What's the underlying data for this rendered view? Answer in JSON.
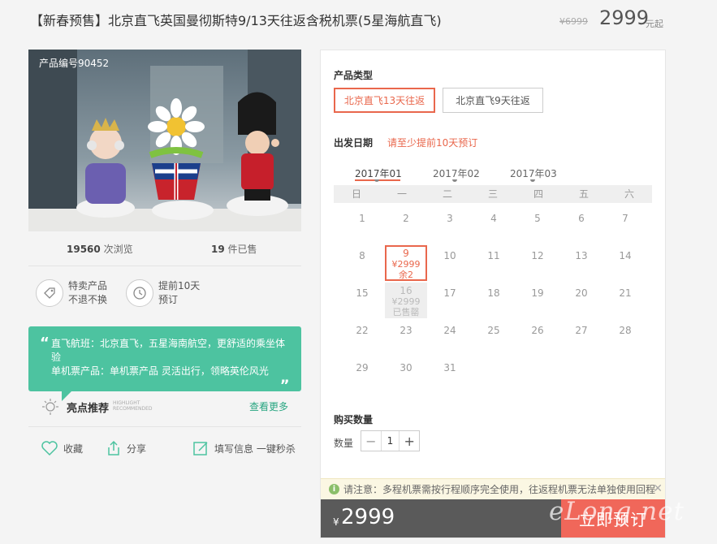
{
  "title": "【新春预售】北京直飞英国曼彻斯特9/13天往返含税机票(5星海航直飞)",
  "original_price": "¥6999",
  "price": "2999",
  "price_suffix": "元起",
  "product_code": "产品编号90452",
  "stats": {
    "views_count": "19560",
    "views_label": "次浏览",
    "sold_count": "19",
    "sold_label": "件已售"
  },
  "features": [
    {
      "line1": "特卖产品",
      "line2": "不退不换",
      "icon": "tag-icon"
    },
    {
      "line1": "提前10天",
      "line2": "预订",
      "icon": "clock-icon"
    }
  ],
  "quote": {
    "line1": "直飞航班：北京直飞，五星海南航空，更舒适的乘坐体验",
    "line2": "单机票产品：单机票产品 灵活出行，领略英伦风光"
  },
  "highlight": {
    "title": "亮点推荐",
    "sub1": "HIGHLIGHT",
    "sub2": "RECOMMENDED",
    "more": "查看更多"
  },
  "actions": {
    "favorite": "收藏",
    "share": "分享",
    "fill_info": "填写信息 一键秒杀"
  },
  "booking": {
    "product_type_label": "产品类型",
    "options": [
      "北京直飞13天往返",
      "北京直飞9天往返"
    ],
    "selected_option": "北京直飞13天往返",
    "departure_label": "出发日期",
    "advance_notice": "请至少提前10天预订",
    "months": [
      "2017年01",
      "2017年02",
      "2017年03"
    ],
    "active_month": "2017年01",
    "weekdays": [
      "日",
      "一",
      "二",
      "三",
      "四",
      "五",
      "六"
    ],
    "calendar_days": [
      "1",
      "2",
      "3",
      "4",
      "5",
      "6",
      "7",
      "8",
      "9",
      "10",
      "11",
      "12",
      "13",
      "14",
      "15",
      "16",
      "17",
      "18",
      "19",
      "20",
      "21",
      "22",
      "23",
      "24",
      "25",
      "26",
      "27",
      "28",
      "29",
      "30",
      "31"
    ],
    "selected_day": {
      "day": "9",
      "price": "¥2999",
      "remaining": "余2"
    },
    "soldout_day": {
      "day": "16",
      "price": "¥2999",
      "status": "已售罄"
    },
    "quantity_label_section": "购买数量",
    "quantity_label": "数量",
    "quantity_minus": "−",
    "quantity_value": "1",
    "quantity_plus": "+",
    "tip": "请注意：多程机票需按行程顺序完全使用，往返程机票无法单独使用回程",
    "tip_close": "✕",
    "total_currency": "¥",
    "total_price": "2999",
    "buy_button": "立即预订"
  },
  "watermark": "eLong.net"
}
